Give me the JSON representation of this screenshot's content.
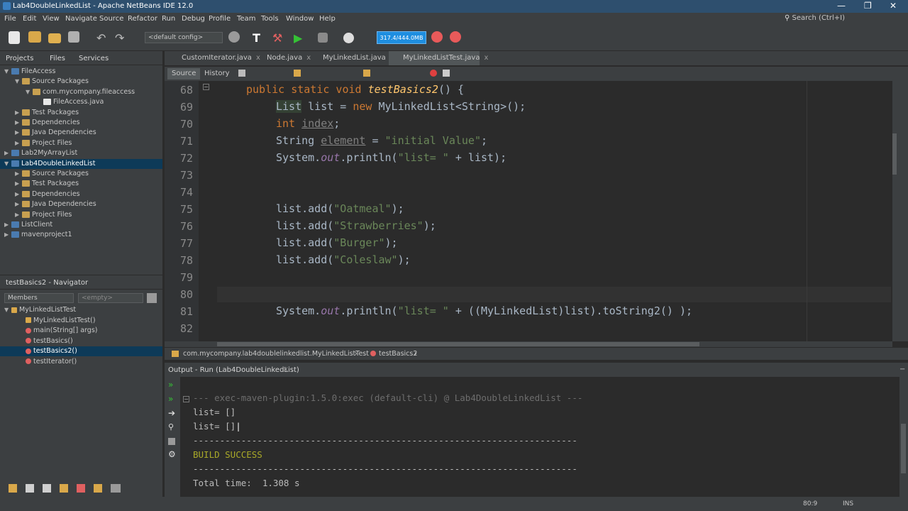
{
  "window": {
    "title": "Lab4DoubleLinkedList - Apache NetBeans IDE 12.0",
    "min": "—",
    "max": "❐",
    "close": "✕"
  },
  "menu": [
    "File",
    "Edit",
    "View",
    "Navigate",
    "Source",
    "Refactor",
    "Run",
    "Debug",
    "Profile",
    "Team",
    "Tools",
    "Window",
    "Help"
  ],
  "search": {
    "placeholder": "Search (Ctrl+I)"
  },
  "toolbar": {
    "config": "<default config>",
    "memory": "317.4/444.0MB"
  },
  "projects": {
    "tabs": [
      "Projects",
      "Files",
      "Services"
    ],
    "tree": [
      {
        "label": "FileAccess",
        "depth": 0,
        "arrow": "▼",
        "type": "proj"
      },
      {
        "label": "Source Packages",
        "depth": 1,
        "arrow": "▼",
        "type": "folder"
      },
      {
        "label": "com.mycompany.fileaccess",
        "depth": 2,
        "arrow": "▼",
        "type": "pkg"
      },
      {
        "label": "FileAccess.java",
        "depth": 3,
        "arrow": "",
        "type": "java"
      },
      {
        "label": "Test Packages",
        "depth": 1,
        "arrow": "▶",
        "type": "folder"
      },
      {
        "label": "Dependencies",
        "depth": 1,
        "arrow": "▶",
        "type": "folder"
      },
      {
        "label": "Java Dependencies",
        "depth": 1,
        "arrow": "▶",
        "type": "folder"
      },
      {
        "label": "Project Files",
        "depth": 1,
        "arrow": "▶",
        "type": "folder"
      },
      {
        "label": "Lab2MyArrayList",
        "depth": 0,
        "arrow": "▶",
        "type": "proj"
      },
      {
        "label": "Lab4DoubleLinkedList",
        "depth": 0,
        "arrow": "▼",
        "type": "proj",
        "selected": true
      },
      {
        "label": "Source Packages",
        "depth": 1,
        "arrow": "▶",
        "type": "folder"
      },
      {
        "label": "Test Packages",
        "depth": 1,
        "arrow": "▶",
        "type": "folder"
      },
      {
        "label": "Dependencies",
        "depth": 1,
        "arrow": "▶",
        "type": "folder"
      },
      {
        "label": "Java Dependencies",
        "depth": 1,
        "arrow": "▶",
        "type": "folder"
      },
      {
        "label": "Project Files",
        "depth": 1,
        "arrow": "▶",
        "type": "folder"
      },
      {
        "label": "ListClient",
        "depth": 0,
        "arrow": "▶",
        "type": "proj"
      },
      {
        "label": "mavenproject1",
        "depth": 0,
        "arrow": "▶",
        "type": "proj"
      }
    ]
  },
  "navigator": {
    "title": "testBasics2 - Navigator",
    "members": "Members",
    "filter": "<empty>",
    "items": [
      {
        "label": "MyLinkedListTest",
        "depth": 0,
        "arrow": "▼",
        "type": "class"
      },
      {
        "label": "MyLinkedListTest()",
        "depth": 1,
        "type": "ctor"
      },
      {
        "label": "main(String[] args)",
        "depth": 1,
        "type": "method"
      },
      {
        "label": "testBasics()",
        "depth": 1,
        "type": "method"
      },
      {
        "label": "testBasics2()",
        "depth": 1,
        "type": "method",
        "selected": true
      },
      {
        "label": "testIterator()",
        "depth": 1,
        "type": "method"
      }
    ]
  },
  "editor": {
    "tabs": [
      {
        "label": "CustomIterator.java",
        "active": false
      },
      {
        "label": "Node.java",
        "active": false
      },
      {
        "label": "MyLinkedList.java",
        "active": false
      },
      {
        "label": "MyLinkedListTest.java",
        "active": true
      }
    ],
    "source_btn": "Source",
    "history_btn": "History",
    "lines": [
      "68",
      "69",
      "70",
      "71",
      "72",
      "73",
      "74",
      "75",
      "76",
      "77",
      "78",
      "79",
      "80",
      "81",
      "82"
    ],
    "breadcrumb": {
      "cls": "com.mycompany.lab4doublelinkedlist.MyLinkedListTest",
      "method": "testBasics2"
    },
    "code": {
      "l68a": "public static void ",
      "l68b": "testBasics2",
      "l68c": "() {",
      "l69a": "List",
      "l69b": " list = ",
      "l69c": "new",
      "l69d": " MyLinkedList<String>();",
      "l70a": "int",
      "l70b": "index",
      "l70c": ";",
      "l71a": "String ",
      "l71b": "element",
      "l71c": " = ",
      "l71d": "\"initial Value\"",
      "l71e": ";",
      "l72a": "System.",
      "l72b": "out",
      "l72c": ".println(",
      "l72d": "\"list= \"",
      "l72e": " + list);",
      "l75a": "list.add(",
      "l75b": "\"Oatmeal\"",
      "l75c": ");",
      "l76a": "list.add(",
      "l76b": "\"Strawberries\"",
      "l76c": ");",
      "l77a": "list.add(",
      "l77b": "\"Burger\"",
      "l77c": ");",
      "l78a": "list.add(",
      "l78b": "\"Coleslaw\"",
      "l78c": ");",
      "l81a": "System.",
      "l81b": "out",
      "l81c": ".println(",
      "l81d": "\"list= \"",
      "l81e": " + ((MyLinkedList)list).toString2() );"
    }
  },
  "output": {
    "title": "Output - Run (Lab4DoubleLinkedList)",
    "lines": [
      {
        "text": "--- exec-maven-plugin:1.5.0:exec (default-cli) @ Lab4DoubleLinkedList ---",
        "color": "#6d6d6d"
      },
      {
        "text": "list= []",
        "color": "#bbbbbb"
      },
      {
        "text": "list= []",
        "color": "#bbbbbb"
      },
      {
        "text": "------------------------------------------------------------------------",
        "color": "#bbbbbb"
      },
      {
        "text": "BUILD SUCCESS",
        "color": "#a9a928"
      },
      {
        "text": "------------------------------------------------------------------------",
        "color": "#bbbbbb"
      },
      {
        "text": "Total time:  1.308 s",
        "color": "#bbbbbb"
      }
    ]
  },
  "status": {
    "position": "80:9",
    "mode": "INS"
  },
  "colors": {
    "accent": "#1e8ee0",
    "selection": "#0d3a58",
    "titlebar": "#2e4f6e"
  }
}
